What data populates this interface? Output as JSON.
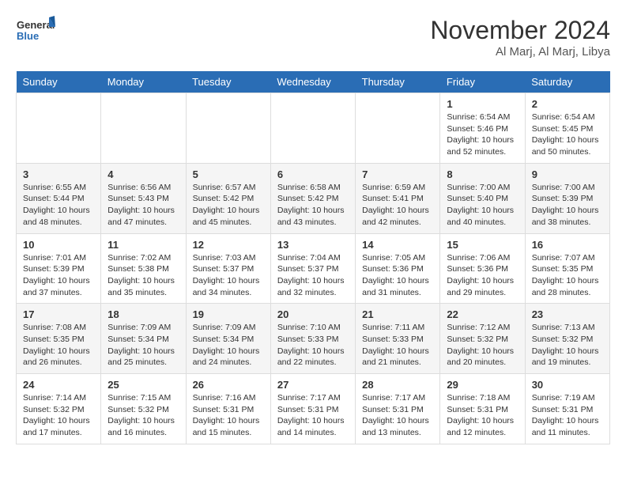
{
  "logo": {
    "text_general": "General",
    "text_blue": "Blue"
  },
  "title": "November 2024",
  "location": "Al Marj, Al Marj, Libya",
  "days_of_week": [
    "Sunday",
    "Monday",
    "Tuesday",
    "Wednesday",
    "Thursday",
    "Friday",
    "Saturday"
  ],
  "weeks": [
    [
      {
        "day": "",
        "info": ""
      },
      {
        "day": "",
        "info": ""
      },
      {
        "day": "",
        "info": ""
      },
      {
        "day": "",
        "info": ""
      },
      {
        "day": "",
        "info": ""
      },
      {
        "day": "1",
        "info": "Sunrise: 6:54 AM\nSunset: 5:46 PM\nDaylight: 10 hours and 52 minutes."
      },
      {
        "day": "2",
        "info": "Sunrise: 6:54 AM\nSunset: 5:45 PM\nDaylight: 10 hours and 50 minutes."
      }
    ],
    [
      {
        "day": "3",
        "info": "Sunrise: 6:55 AM\nSunset: 5:44 PM\nDaylight: 10 hours and 48 minutes."
      },
      {
        "day": "4",
        "info": "Sunrise: 6:56 AM\nSunset: 5:43 PM\nDaylight: 10 hours and 47 minutes."
      },
      {
        "day": "5",
        "info": "Sunrise: 6:57 AM\nSunset: 5:42 PM\nDaylight: 10 hours and 45 minutes."
      },
      {
        "day": "6",
        "info": "Sunrise: 6:58 AM\nSunset: 5:42 PM\nDaylight: 10 hours and 43 minutes."
      },
      {
        "day": "7",
        "info": "Sunrise: 6:59 AM\nSunset: 5:41 PM\nDaylight: 10 hours and 42 minutes."
      },
      {
        "day": "8",
        "info": "Sunrise: 7:00 AM\nSunset: 5:40 PM\nDaylight: 10 hours and 40 minutes."
      },
      {
        "day": "9",
        "info": "Sunrise: 7:00 AM\nSunset: 5:39 PM\nDaylight: 10 hours and 38 minutes."
      }
    ],
    [
      {
        "day": "10",
        "info": "Sunrise: 7:01 AM\nSunset: 5:39 PM\nDaylight: 10 hours and 37 minutes."
      },
      {
        "day": "11",
        "info": "Sunrise: 7:02 AM\nSunset: 5:38 PM\nDaylight: 10 hours and 35 minutes."
      },
      {
        "day": "12",
        "info": "Sunrise: 7:03 AM\nSunset: 5:37 PM\nDaylight: 10 hours and 34 minutes."
      },
      {
        "day": "13",
        "info": "Sunrise: 7:04 AM\nSunset: 5:37 PM\nDaylight: 10 hours and 32 minutes."
      },
      {
        "day": "14",
        "info": "Sunrise: 7:05 AM\nSunset: 5:36 PM\nDaylight: 10 hours and 31 minutes."
      },
      {
        "day": "15",
        "info": "Sunrise: 7:06 AM\nSunset: 5:36 PM\nDaylight: 10 hours and 29 minutes."
      },
      {
        "day": "16",
        "info": "Sunrise: 7:07 AM\nSunset: 5:35 PM\nDaylight: 10 hours and 28 minutes."
      }
    ],
    [
      {
        "day": "17",
        "info": "Sunrise: 7:08 AM\nSunset: 5:35 PM\nDaylight: 10 hours and 26 minutes."
      },
      {
        "day": "18",
        "info": "Sunrise: 7:09 AM\nSunset: 5:34 PM\nDaylight: 10 hours and 25 minutes."
      },
      {
        "day": "19",
        "info": "Sunrise: 7:09 AM\nSunset: 5:34 PM\nDaylight: 10 hours and 24 minutes."
      },
      {
        "day": "20",
        "info": "Sunrise: 7:10 AM\nSunset: 5:33 PM\nDaylight: 10 hours and 22 minutes."
      },
      {
        "day": "21",
        "info": "Sunrise: 7:11 AM\nSunset: 5:33 PM\nDaylight: 10 hours and 21 minutes."
      },
      {
        "day": "22",
        "info": "Sunrise: 7:12 AM\nSunset: 5:32 PM\nDaylight: 10 hours and 20 minutes."
      },
      {
        "day": "23",
        "info": "Sunrise: 7:13 AM\nSunset: 5:32 PM\nDaylight: 10 hours and 19 minutes."
      }
    ],
    [
      {
        "day": "24",
        "info": "Sunrise: 7:14 AM\nSunset: 5:32 PM\nDaylight: 10 hours and 17 minutes."
      },
      {
        "day": "25",
        "info": "Sunrise: 7:15 AM\nSunset: 5:32 PM\nDaylight: 10 hours and 16 minutes."
      },
      {
        "day": "26",
        "info": "Sunrise: 7:16 AM\nSunset: 5:31 PM\nDaylight: 10 hours and 15 minutes."
      },
      {
        "day": "27",
        "info": "Sunrise: 7:17 AM\nSunset: 5:31 PM\nDaylight: 10 hours and 14 minutes."
      },
      {
        "day": "28",
        "info": "Sunrise: 7:17 AM\nSunset: 5:31 PM\nDaylight: 10 hours and 13 minutes."
      },
      {
        "day": "29",
        "info": "Sunrise: 7:18 AM\nSunset: 5:31 PM\nDaylight: 10 hours and 12 minutes."
      },
      {
        "day": "30",
        "info": "Sunrise: 7:19 AM\nSunset: 5:31 PM\nDaylight: 10 hours and 11 minutes."
      }
    ]
  ]
}
